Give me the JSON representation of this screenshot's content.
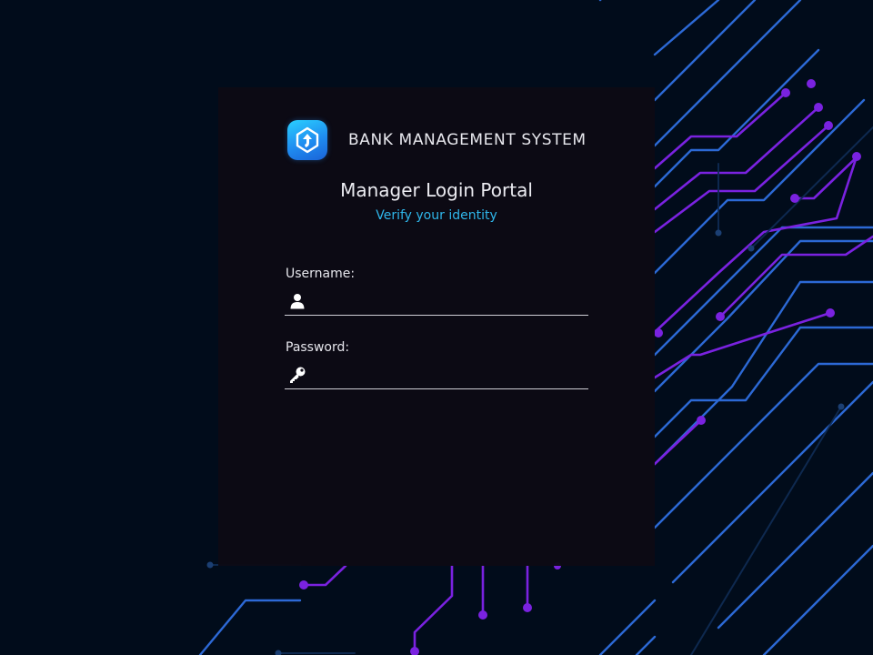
{
  "app": {
    "name": "BANK MANAGEMENT SYSTEM",
    "logo_icon": "arrow-up-badge-icon"
  },
  "portal": {
    "title": "Manager Login Portal",
    "subtitle": "Verify your identity"
  },
  "form": {
    "username": {
      "label": "Username:",
      "value": "",
      "icon": "user-icon"
    },
    "password": {
      "label": "Password:",
      "value": "",
      "icon": "key-icon"
    }
  },
  "colors": {
    "background": "#010c1b",
    "card": "#0d0a14",
    "accent_cyan": "#2fb6ea",
    "circuit_blue": "#2f6fe0",
    "circuit_purple": "#7a22e0"
  }
}
